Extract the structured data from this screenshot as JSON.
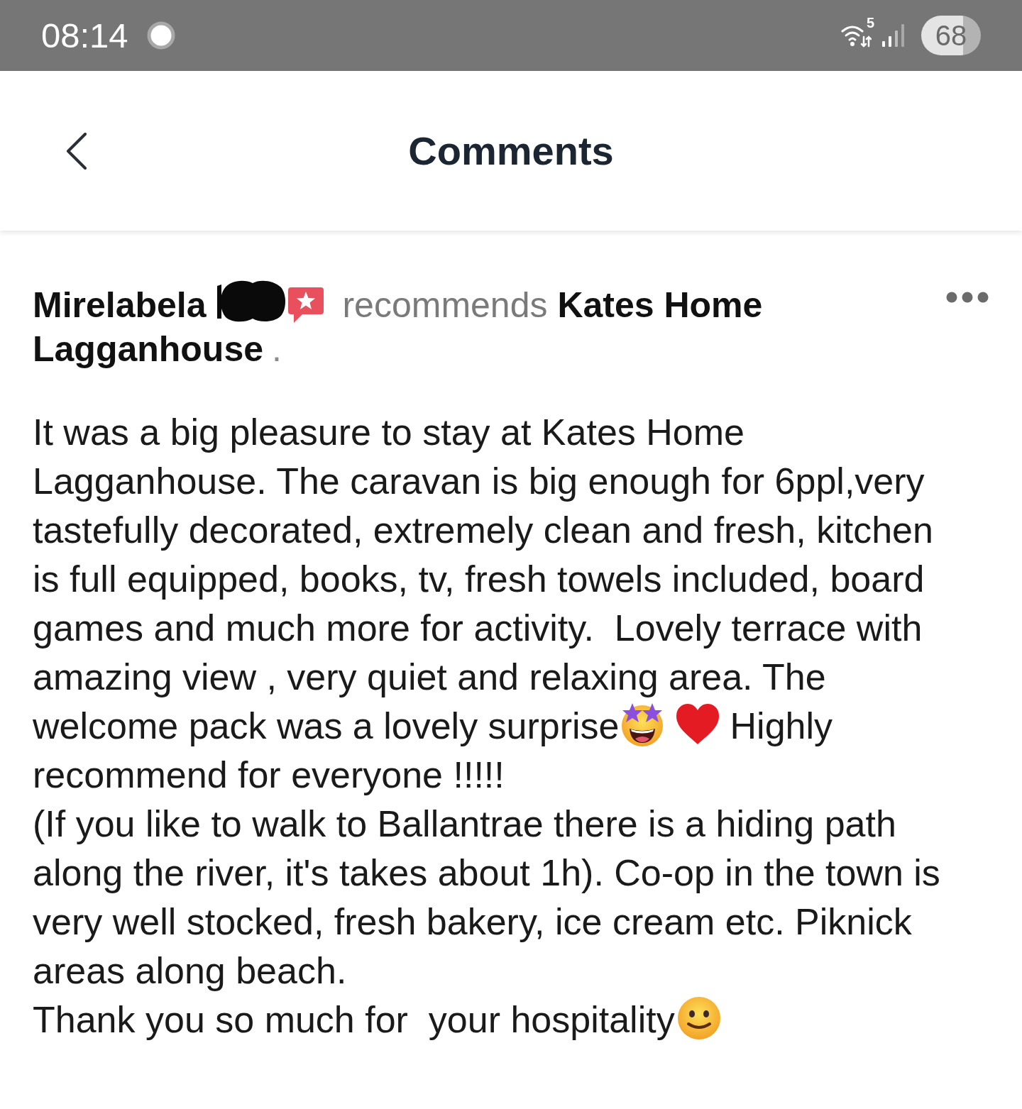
{
  "status_bar": {
    "time": "08:14",
    "wifi_band": "5",
    "battery": "68"
  },
  "header": {
    "title": "Comments"
  },
  "comment": {
    "author": "Mirelabela",
    "action": "recommends",
    "place": "Kates Home Lagganhouse",
    "end": ".",
    "paragraphs": [
      [
        {
          "kind": "text",
          "text": "It was a big pleasure to stay at Kates Home Lagganhouse. The caravan is big enough for 6ppl,very tastefully decorated, extremely clean and fresh, kitchen is full equipped, books, tv, fresh towels included, board games and much more for activity.  Lovely terrace with amazing view , very quiet and relaxing area. The welcome pack was a lovely surprise"
        },
        {
          "kind": "starstruck"
        },
        {
          "kind": "heart"
        },
        {
          "kind": "text",
          "text": "Highly recommend for everyone !!!!!"
        }
      ],
      [
        {
          "kind": "text",
          "text": "(If you like to walk to Ballantrae there is a hiding path along the river, it's takes about 1h). Co-op in the town is very well stocked, fresh bakery, ice cream etc. Piknick areas along beach."
        }
      ],
      [
        {
          "kind": "text",
          "text": "Thank you so much for  your hospitality"
        },
        {
          "kind": "smile"
        }
      ]
    ]
  }
}
